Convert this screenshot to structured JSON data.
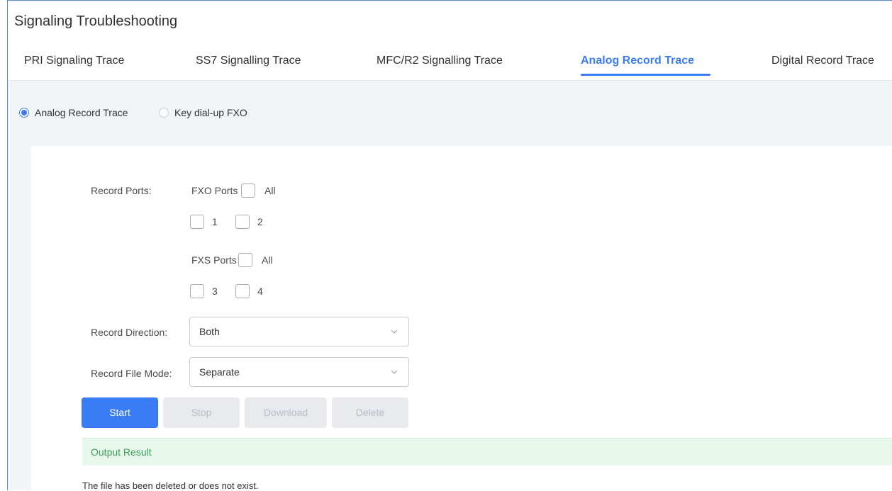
{
  "page": {
    "title": "Signaling Troubleshooting"
  },
  "tabs": [
    {
      "label": "PRI Signaling Trace",
      "active": false
    },
    {
      "label": "SS7 Signalling Trace",
      "active": false
    },
    {
      "label": "MFC/R2 Signalling Trace",
      "active": false
    },
    {
      "label": "Analog Record Trace",
      "active": true
    },
    {
      "label": "Digital Record Trace",
      "active": false
    }
  ],
  "mode": {
    "options": [
      {
        "label": "Analog Record Trace",
        "checked": true
      },
      {
        "label": "Key dial-up FXO",
        "checked": false
      }
    ]
  },
  "form": {
    "record_ports_label": "Record Ports:",
    "fxo": {
      "label": "FXO Ports",
      "all_label": "All",
      "all_checked": false,
      "ports": [
        {
          "label": "1",
          "checked": false
        },
        {
          "label": "2",
          "checked": false
        }
      ]
    },
    "fxs": {
      "label": "FXS Ports",
      "all_label": "All",
      "all_checked": false,
      "ports": [
        {
          "label": "3",
          "checked": false
        },
        {
          "label": "4",
          "checked": false
        }
      ]
    },
    "direction": {
      "label": "Record Direction:",
      "value": "Both"
    },
    "file_mode": {
      "label": "Record File Mode:",
      "value": "Separate"
    }
  },
  "buttons": {
    "start": "Start",
    "stop": "Stop",
    "download": "Download",
    "delete": "Delete"
  },
  "output": {
    "header": "Output Result",
    "message": "The file has been deleted or does not exist."
  },
  "colors": {
    "accent": "#3a7cf6",
    "success_bg": "#e8f8ec",
    "success_text": "#3c9c57",
    "disabled_bg": "#e8eaee"
  }
}
